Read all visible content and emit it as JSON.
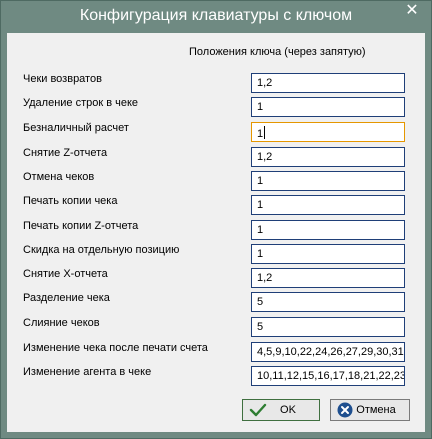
{
  "window": {
    "title": "Конфигурация клавиатуры с ключом"
  },
  "header": "Положения ключа (через запятую)",
  "rows": [
    {
      "label": "Чеки возвратов",
      "value": "1,2"
    },
    {
      "label": "Удаление строк в чеке",
      "value": "1"
    },
    {
      "label": "Безналичный расчет",
      "value": "1"
    },
    {
      "label": "Снятие Z-отчета",
      "value": "1,2"
    },
    {
      "label": "Отмена чеков",
      "value": "1"
    },
    {
      "label": "Печать копии чека",
      "value": "1"
    },
    {
      "label": "Печать копии Z-отчета",
      "value": "1"
    },
    {
      "label": "Скидка на отдельную позицию",
      "value": "1"
    },
    {
      "label": "Снятие X-отчета",
      "value": "1,2"
    },
    {
      "label": "Разделение чека",
      "value": "5"
    },
    {
      "label": "Слияние чеков",
      "value": "5"
    },
    {
      "label": "Изменение чека после печати счета",
      "value": "4,5,9,10,22,24,26,27,29,30,31"
    },
    {
      "label": "Изменение агента в чеке",
      "value": "10,11,12,15,16,17,18,21,22,23"
    }
  ],
  "buttons": {
    "ok": "OK",
    "cancel": "Отмена"
  },
  "colors": {
    "titlebar": "#6f8a82",
    "field_border": "#1f3f78",
    "focus_border": "#e59700",
    "ok_icon": "#2e7d32",
    "cancel_icon": "#1e4f8f"
  }
}
